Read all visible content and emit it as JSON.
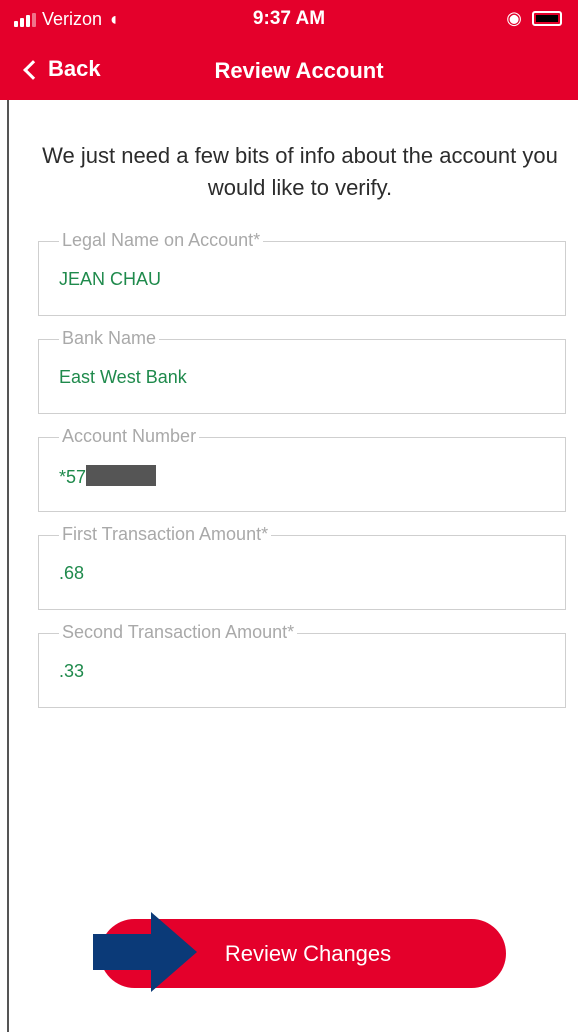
{
  "status_bar": {
    "carrier": "Verizon",
    "time": "9:37 AM"
  },
  "nav": {
    "back_label": "Back",
    "title": "Review Account"
  },
  "intro_text": "We just need a few bits of info about the account you would like to verify.",
  "fields": [
    {
      "label": "Legal Name on Account*",
      "value": "JEAN CHAU"
    },
    {
      "label": "Bank Name",
      "value": "East West Bank"
    },
    {
      "label": "Account Number",
      "value": "*57"
    },
    {
      "label": "First Transaction Amount*",
      "value": ".68"
    },
    {
      "label": "Second Transaction Amount*",
      "value": ".33"
    }
  ],
  "review_button_label": "Review Changes",
  "colors": {
    "brand_red": "#e4002b",
    "value_green": "#1f8a4c",
    "arrow_blue": "#0b3a78"
  }
}
